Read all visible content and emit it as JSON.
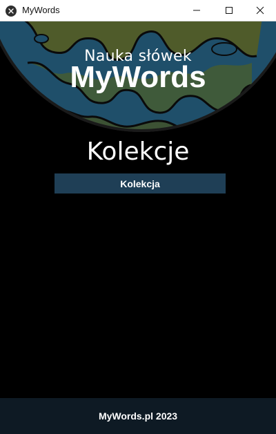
{
  "window": {
    "title": "MyWords",
    "icon": "kivy-app-icon",
    "controls": {
      "minimize": "minimize-icon",
      "maximize": "maximize-icon",
      "close": "close-icon"
    }
  },
  "header": {
    "subtitle": "Nauka słówek",
    "title": "MyWords",
    "background": "globe-map-image"
  },
  "main": {
    "heading": "Kolekcje",
    "collections": [
      {
        "label": "Kolekcja"
      }
    ]
  },
  "footer": {
    "text": "MyWords.pl 2023"
  },
  "colors": {
    "background": "#000000",
    "button": "#1f3f56",
    "footer": "#0e1a24",
    "text": "#ffffff"
  }
}
